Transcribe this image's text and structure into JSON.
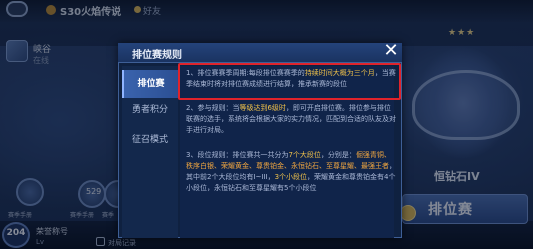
{
  "top_bar": {
    "title": "S30火焰传说",
    "tag": "好友"
  },
  "left_panel": {
    "label": "峡谷",
    "sub": "在线",
    "badge_number": "529",
    "badge_captions": [
      "赛季手册",
      "赛季手册",
      "赛季"
    ]
  },
  "bottom_bar": {
    "level": "204",
    "name": "荣誉称号",
    "sub": "Lv",
    "record_label": "对局记录"
  },
  "rank_area": {
    "stars": "★★★",
    "label": "恒钻石IV",
    "ranked_button": "排位赛"
  },
  "modal": {
    "title": "排位赛规则",
    "close_symbol": "✕",
    "tabs": [
      {
        "label": "排位赛"
      },
      {
        "label": "勇者积分"
      },
      {
        "label": "征召模式"
      }
    ],
    "paragraphs": {
      "p1_a": "1、排位赛赛季周期:每段排位赛赛季的",
      "p1_hl": "持续时间大概为三个月",
      "p1_b": "，当赛季结束时将对排位赛成绩进行结算，推承新赛的段位",
      "p2_a": "2、参与规则：当",
      "p2_hl": "等级达到6级时",
      "p2_b": "，即可开启排位赛。排位参与排位联赛的选手，系统将会根据大家的实力情况，匹配到合适的队友及对手进行对局。",
      "p3_a": "3、段位规则：排位赛共一共分为",
      "p3_hl1": "7个大段位",
      "p3_b": "，分别是：",
      "p3_hl2": "倔强青铜、秩序白银、荣耀黄金、尊贵铂金、永恒钻石、至尊星耀、最强王者",
      "p3_c": "，其中前2个大段位均有I~III，",
      "p3_hl3": "3个小段位",
      "p3_d": "，荣耀黄金和尊贵铂金有4个小段位，永恒钻石和至尊星耀有5个小段位"
    }
  }
}
